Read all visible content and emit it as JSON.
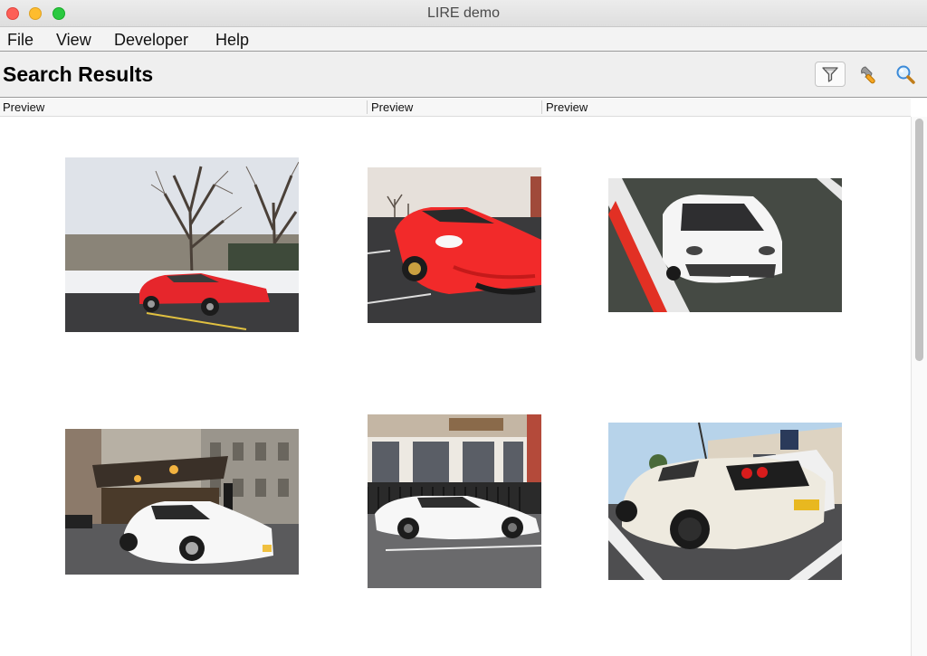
{
  "window": {
    "title": "LIRE demo"
  },
  "menu": {
    "items": [
      "File",
      "View",
      "Developer",
      "Help"
    ]
  },
  "header": {
    "title": "Search Results"
  },
  "toolbar": {
    "icons": [
      "funnel-icon",
      "wrench-icon",
      "magnifier-icon"
    ]
  },
  "table": {
    "columns": [
      "Preview",
      "Preview",
      "Preview"
    ]
  },
  "results": [
    {
      "icon": "red-car-winter-trees-photo"
    },
    {
      "icon": "red-car-parking-lot-photo"
    },
    {
      "icon": "white-car-racetrack-photo"
    },
    {
      "icon": "white-car-hotel-entrance-photo"
    },
    {
      "icon": "white-car-storefront-photo"
    },
    {
      "icon": "white-car-street-photo"
    }
  ],
  "colors": {
    "accent_red": "#e6262c",
    "titlebar": "#e4e4e4"
  }
}
